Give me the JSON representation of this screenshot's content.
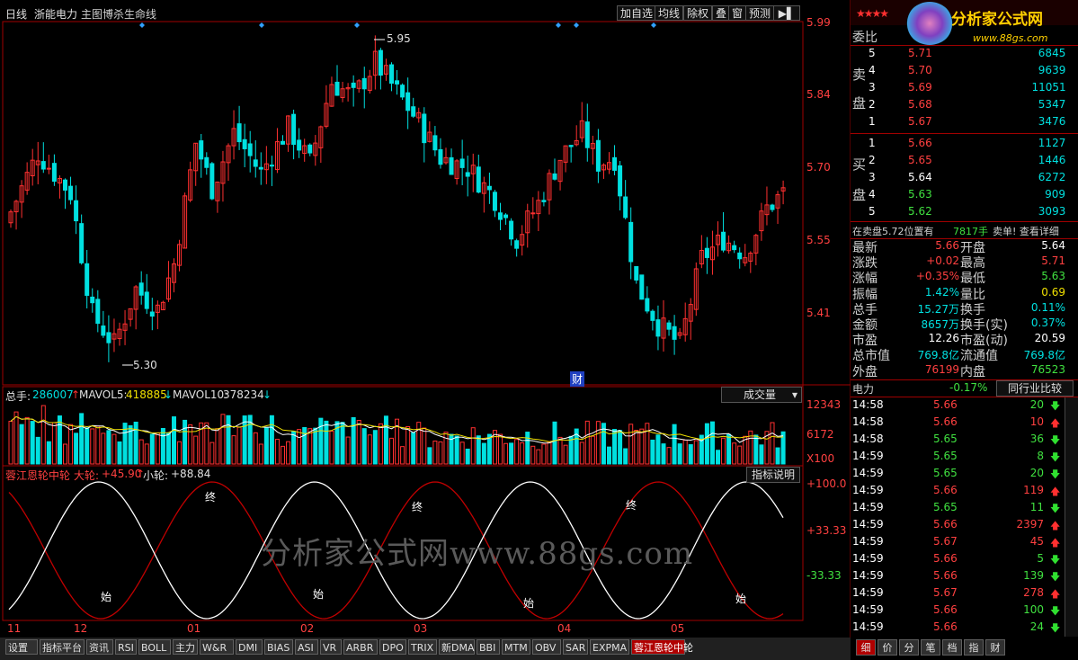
{
  "header": {
    "period": "日线",
    "stock_name": "浙能电力",
    "formula": "主图博杀生命线",
    "buttons": [
      "加自选",
      "均线",
      "除权",
      "叠",
      "窗",
      "预测"
    ],
    "nav_icon": "arrow-right-icon"
  },
  "price_axis": [
    "5.99",
    "5.84",
    "5.70",
    "5.55",
    "5.41"
  ],
  "annotations": {
    "high": "5.95",
    "low": "5.30",
    "cai": "财"
  },
  "volume_panel": {
    "total_label": "总手:",
    "total_value": "286007",
    "mavol5_label": "MAVOL5:",
    "mavol5_value": "418885",
    "mavol10_label": "MAVOL10:",
    "mavol10_value": "378234",
    "dropdown": "成交量",
    "axis": [
      "12343",
      "6172",
      "X100"
    ]
  },
  "indicator_panel": {
    "name": "蓉江恩轮中轮",
    "big_label": "大轮:",
    "big_value": "+45.90",
    "small_label": "小轮:",
    "small_value": "+88.84",
    "help_button": "指标说明",
    "axis": [
      "+100.0",
      "+33.33",
      "-33.33"
    ],
    "marks_start": "始",
    "marks_end": "终"
  },
  "watermark": "分析家公式网www.88gs.com",
  "x_axis": [
    "11",
    "12",
    "01",
    "02",
    "03",
    "04",
    "05"
  ],
  "bottom_tabs": [
    "设置",
    "指标平台",
    "资讯",
    "RSI",
    "BOLL",
    "主力",
    "W&R",
    "DMI",
    "BIAS",
    "ASI",
    "VR",
    "ARBR",
    "DPO",
    "TRIX",
    "新DMA",
    "BBI",
    "MTM",
    "OBV",
    "SAR",
    "EXPMA",
    "蓉江恩轮中轮"
  ],
  "side": {
    "logo_text": "分析家公式网",
    "logo_url": "www.88gs.com",
    "weibi": "委比",
    "sell_label": [
      "卖",
      "盘"
    ],
    "buy_label": [
      "买",
      "盘"
    ],
    "sell": [
      {
        "lvl": "5",
        "price": "5.71",
        "vol": "6845"
      },
      {
        "lvl": "4",
        "price": "5.70",
        "vol": "9639"
      },
      {
        "lvl": "3",
        "price": "5.69",
        "vol": "11051"
      },
      {
        "lvl": "2",
        "price": "5.68",
        "vol": "5347"
      },
      {
        "lvl": "1",
        "price": "5.67",
        "vol": "3476"
      }
    ],
    "buy": [
      {
        "lvl": "1",
        "price": "5.66",
        "vol": "1127"
      },
      {
        "lvl": "2",
        "price": "5.65",
        "vol": "1446"
      },
      {
        "lvl": "3",
        "price": "5.64",
        "vol": "6272"
      },
      {
        "lvl": "4",
        "price": "5.63",
        "vol": "909"
      },
      {
        "lvl": "5",
        "price": "5.62",
        "vol": "3093"
      }
    ],
    "notice": "在卖盘5.72位置有",
    "notice_vol": "7817手",
    "notice_tail": "卖单! 查看详细",
    "stats": [
      {
        "l1": "最新",
        "v1": "5.66",
        "l2": "开盘",
        "v2": "5.64",
        "c1": "red",
        "c2": "white"
      },
      {
        "l1": "涨跌",
        "v1": "+0.02",
        "l2": "最高",
        "v2": "5.71",
        "c1": "red",
        "c2": "red"
      },
      {
        "l1": "涨幅",
        "v1": "+0.35%",
        "l2": "最低",
        "v2": "5.63",
        "c1": "red",
        "c2": "green"
      },
      {
        "l1": "振幅",
        "v1": "1.42%",
        "l2": "量比",
        "v2": "0.69",
        "c1": "cyan",
        "c2": "yellow"
      },
      {
        "l1": "总手",
        "v1": "15.27万",
        "l2": "换手",
        "v2": "0.11%",
        "c1": "cyan",
        "c2": "cyan"
      },
      {
        "l1": "金额",
        "v1": "8657万",
        "l2": "换手(实)",
        "v2": "0.37%",
        "c1": "cyan",
        "c2": "cyan"
      },
      {
        "l1": "市盈",
        "v1": "12.26",
        "l2": "市盈(动)",
        "v2": "20.59",
        "c1": "white",
        "c2": "white"
      },
      {
        "l1": "总市值",
        "v1": "769.8亿",
        "l2": "流通值",
        "v2": "769.8亿",
        "c1": "cyan",
        "c2": "cyan"
      },
      {
        "l1": "外盘",
        "v1": "76199",
        "l2": "内盘",
        "v2": "76523",
        "c1": "red",
        "c2": "green"
      }
    ],
    "sector": "电力",
    "sector_change": "-0.17%",
    "compare_btn": "同行业比较",
    "ticks": [
      {
        "t": "14:58",
        "p": "5.66",
        "v": "20",
        "d": "dn"
      },
      {
        "t": "14:58",
        "p": "5.66",
        "v": "10",
        "d": "up"
      },
      {
        "t": "14:58",
        "p": "5.65",
        "v": "36",
        "d": "dn"
      },
      {
        "t": "14:59",
        "p": "5.65",
        "v": "8",
        "d": "dn"
      },
      {
        "t": "14:59",
        "p": "5.65",
        "v": "20",
        "d": "dn"
      },
      {
        "t": "14:59",
        "p": "5.66",
        "v": "119",
        "d": "up"
      },
      {
        "t": "14:59",
        "p": "5.65",
        "v": "11",
        "d": "dn"
      },
      {
        "t": "14:59",
        "p": "5.66",
        "v": "2397",
        "d": "up"
      },
      {
        "t": "14:59",
        "p": "5.67",
        "v": "45",
        "d": "up"
      },
      {
        "t": "14:59",
        "p": "5.66",
        "v": "5",
        "d": "dn"
      },
      {
        "t": "14:59",
        "p": "5.66",
        "v": "139",
        "d": "dn"
      },
      {
        "t": "14:59",
        "p": "5.67",
        "v": "278",
        "d": "up"
      },
      {
        "t": "14:59",
        "p": "5.66",
        "v": "100",
        "d": "dn"
      },
      {
        "t": "14:59",
        "p": "5.66",
        "v": "24",
        "d": "dn"
      }
    ],
    "side_tabs": [
      "细",
      "价",
      "分",
      "笔",
      "档",
      "指",
      "财"
    ]
  },
  "colors": {
    "up": "#ff3030",
    "down": "#00e0e0",
    "ma_white": "#ffffff",
    "ma_yellow": "#f0e000",
    "grid": "#a00000",
    "big_wheel": "#c00000",
    "small_wheel": "#ffffff"
  }
}
